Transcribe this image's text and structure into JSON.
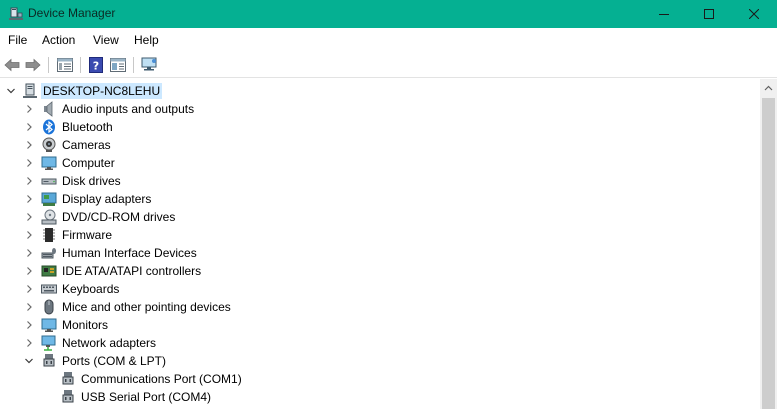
{
  "window": {
    "title": "Device Manager",
    "title_bar_color": "#05b092",
    "icon": "device-manager-icon"
  },
  "menu": {
    "file": "File",
    "action": "Action",
    "view": "View",
    "help": "Help"
  },
  "toolbar": {
    "items": [
      "back-arrow-icon",
      "forward-arrow-icon",
      "properties-icon",
      "help-icon",
      "update-driver-icon",
      "scan-hardware-icon"
    ]
  },
  "tree": {
    "root": {
      "label": "DESKTOP-NC8LEHU",
      "icon": "computer-tower-icon",
      "expanded": true
    },
    "categories": [
      {
        "label": "Audio inputs and outputs",
        "icon": "speaker-icon",
        "expanded": false
      },
      {
        "label": "Bluetooth",
        "icon": "bluetooth-icon",
        "expanded": false
      },
      {
        "label": "Cameras",
        "icon": "camera-icon",
        "expanded": false
      },
      {
        "label": "Computer",
        "icon": "monitor-icon",
        "expanded": false
      },
      {
        "label": "Disk drives",
        "icon": "disk-drive-icon",
        "expanded": false
      },
      {
        "label": "Display adapters",
        "icon": "display-adapter-icon",
        "expanded": false
      },
      {
        "label": "DVD/CD-ROM drives",
        "icon": "optical-drive-icon",
        "expanded": false
      },
      {
        "label": "Firmware",
        "icon": "chip-icon",
        "expanded": false
      },
      {
        "label": "Human Interface Devices",
        "icon": "hid-icon",
        "expanded": false
      },
      {
        "label": "IDE ATA/ATAPI controllers",
        "icon": "ide-controller-icon",
        "expanded": false
      },
      {
        "label": "Keyboards",
        "icon": "keyboard-icon",
        "expanded": false
      },
      {
        "label": "Mice and other pointing devices",
        "icon": "mouse-icon",
        "expanded": false
      },
      {
        "label": "Monitors",
        "icon": "monitor-icon",
        "expanded": false
      },
      {
        "label": "Network adapters",
        "icon": "network-adapter-icon",
        "expanded": false
      },
      {
        "label": "Ports (COM & LPT)",
        "icon": "port-icon",
        "expanded": true
      }
    ],
    "port_children": [
      {
        "label": "Communications Port (COM1)",
        "icon": "port-icon"
      },
      {
        "label": "USB Serial Port (COM4)",
        "icon": "port-icon"
      }
    ]
  },
  "colors": {
    "selection": "#cce8ff",
    "scrollbar_track": "#f0f0f0",
    "scrollbar_thumb": "#cdcdcd"
  }
}
